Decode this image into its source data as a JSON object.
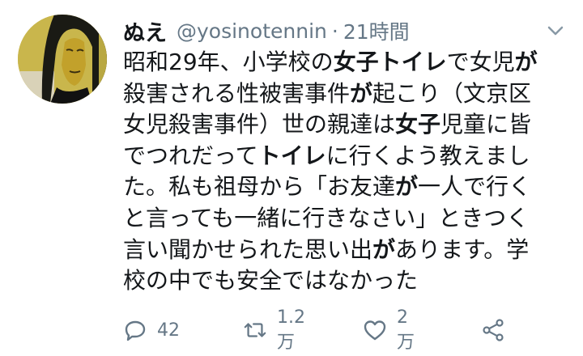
{
  "user": {
    "display_name": "ぬえ",
    "handle": "@yosinotennin",
    "separator": "·",
    "time": "21時間"
  },
  "tweet": {
    "lines": [
      [
        "昭和29年、小学校の",
        "女子トイレ",
        "で女児",
        "が",
        ""
      ],
      [
        "殺害される性被害事件",
        "が",
        "起こり（文京区",
        "",
        ""
      ],
      [
        "女児殺害事件）世の親達は",
        "女子",
        "児童に皆",
        "",
        ""
      ],
      [
        "でつれだって",
        "トイレ",
        "に行くよう教えまし",
        "",
        ""
      ],
      [
        "た。私も祖母から「お友達",
        "が",
        "一人で行く",
        "",
        ""
      ],
      [
        "と言っても一緒に行きなさい」ときつく",
        "",
        "",
        "",
        ""
      ],
      [
        "言い聞かせられた思い出",
        "が",
        "あります。学",
        "",
        ""
      ],
      [
        "校の中でも安全ではなかった",
        "",
        "",
        "",
        ""
      ]
    ]
  },
  "actions": {
    "reply_icon": "reply-icon",
    "reply_count": "42",
    "retweet_icon": "retweet-icon",
    "retweet_count": "1.2万",
    "like_icon": "heart-icon",
    "like_count": "2万",
    "share_icon": "share-icon"
  },
  "colors": {
    "text": "#14171a",
    "muted": "#657786",
    "icon": "#657786",
    "avatar_bg": "#c7b44a"
  }
}
